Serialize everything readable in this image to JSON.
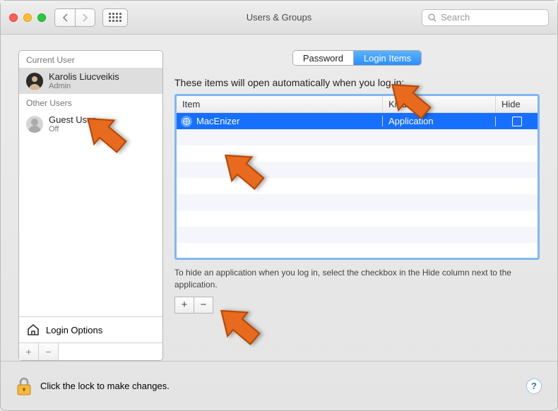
{
  "window": {
    "title": "Users & Groups"
  },
  "search": {
    "placeholder": "Search"
  },
  "sidebar": {
    "current_label": "Current User",
    "other_label": "Other Users",
    "current": {
      "name": "Karolis Liucveikis",
      "role": "Admin"
    },
    "other": [
      {
        "name": "Guest User",
        "role": "Off"
      }
    ],
    "login_options": "Login Options"
  },
  "tabs": {
    "password": "Password",
    "login_items": "Login Items"
  },
  "main": {
    "headline": "These items will open automatically when you log in:",
    "columns": {
      "item": "Item",
      "kind": "Kind",
      "hide": "Hide"
    },
    "rows": [
      {
        "name": "MacEnizer",
        "kind": "Application",
        "hide": false
      }
    ],
    "hint": "To hide an application when you log in, select the checkbox in the Hide column next to the application."
  },
  "footer": {
    "lock_text": "Click the lock to make changes."
  }
}
